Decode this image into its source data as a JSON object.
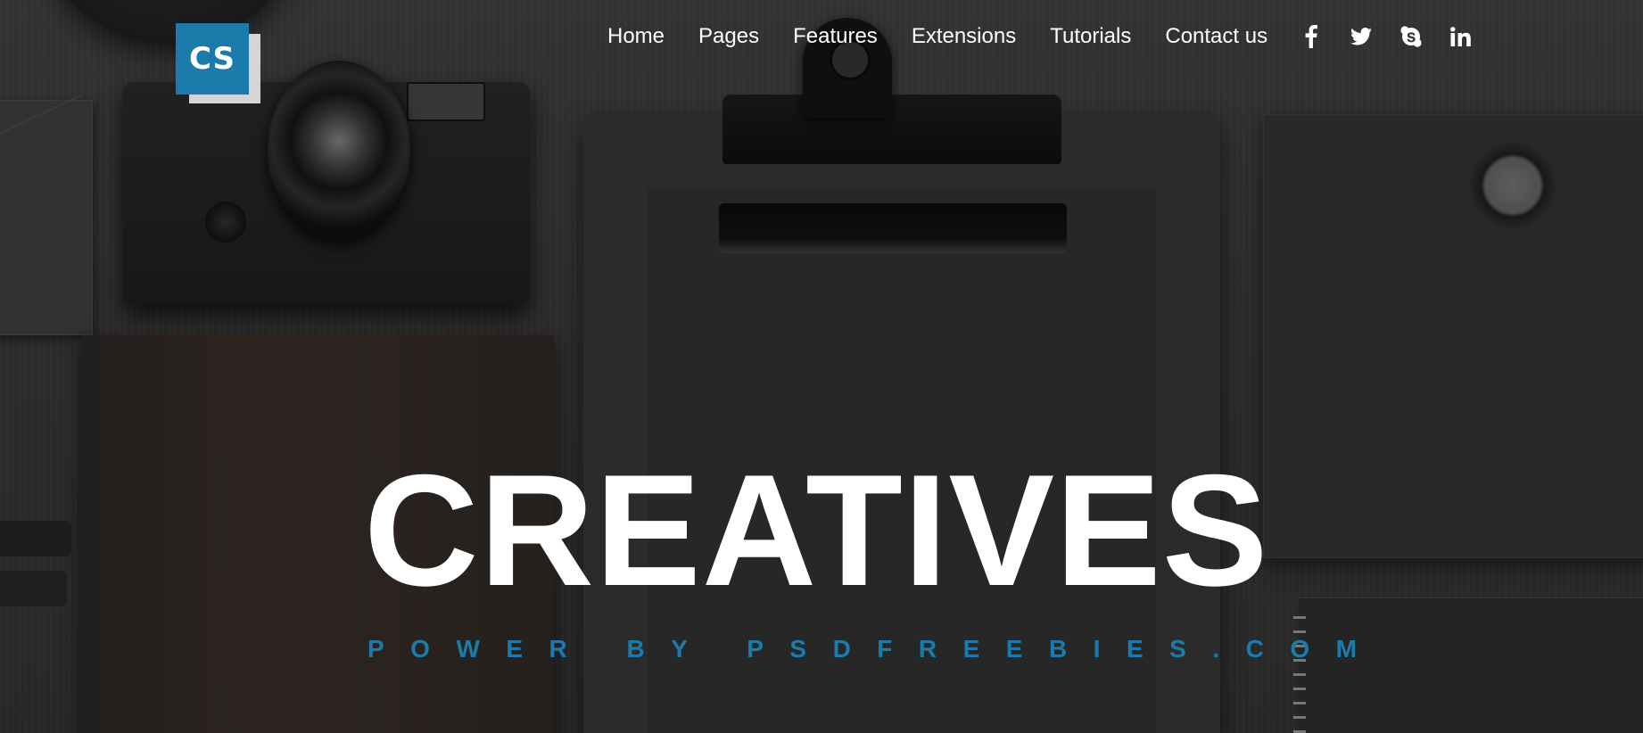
{
  "logo": {
    "text": "CS",
    "accent": "#1b7bab"
  },
  "nav": {
    "items": [
      {
        "label": "Home"
      },
      {
        "label": "Pages"
      },
      {
        "label": "Features"
      },
      {
        "label": "Extensions"
      },
      {
        "label": "Tutorials"
      },
      {
        "label": "Contact us"
      }
    ],
    "social": [
      {
        "icon": "facebook-icon"
      },
      {
        "icon": "twitter-icon"
      },
      {
        "icon": "skype-icon"
      },
      {
        "icon": "linkedin-icon"
      }
    ]
  },
  "hero": {
    "headline": "CREATIVES",
    "tagline": "POWER BY PSDFREEBIES.COM",
    "headline_color": "#ffffff",
    "tagline_color": "#1b7bab"
  }
}
